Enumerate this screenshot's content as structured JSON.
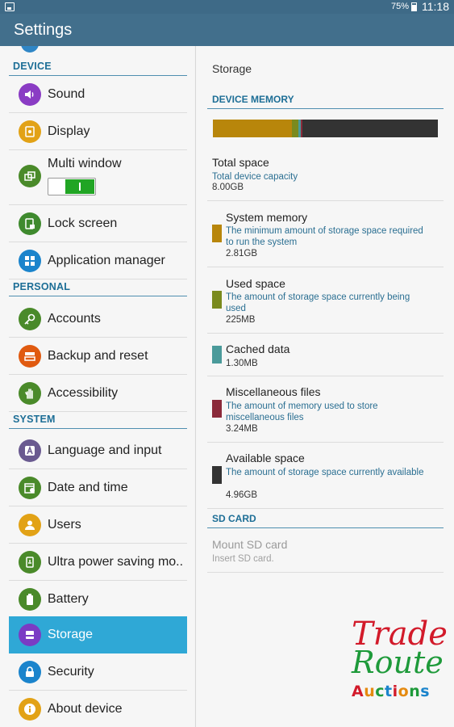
{
  "status": {
    "battery": "75%",
    "time": "11:18"
  },
  "app": {
    "title": "Settings"
  },
  "left": {
    "sections": {
      "device": "DEVICE",
      "personal": "PERSONAL",
      "system": "SYSTEM"
    },
    "items": {
      "sound": "Sound",
      "display": "Display",
      "multi_window": "Multi window",
      "lock_screen": "Lock screen",
      "app_manager": "Application manager",
      "accounts": "Accounts",
      "backup": "Backup and reset",
      "accessibility": "Accessibility",
      "language": "Language and input",
      "date_time": "Date and time",
      "users": "Users",
      "ultra_power": "Ultra power saving mo..",
      "battery": "Battery",
      "storage": "Storage",
      "security": "Security",
      "about": "About device"
    },
    "multi_window_enabled": true,
    "selected": "storage"
  },
  "right": {
    "title": "Storage",
    "device_memory_header": "DEVICE MEMORY",
    "usage_bar": [
      {
        "name": "System memory",
        "fraction": 0.351,
        "color": "#b8860b"
      },
      {
        "name": "Used space",
        "fraction": 0.028,
        "color": "#7a8a1e"
      },
      {
        "name": "Cached data",
        "fraction": 0.01,
        "color": "#4a9a9a"
      },
      {
        "name": "Miscellaneous files",
        "fraction": 0.01,
        "color": "#8b2a3a"
      },
      {
        "name": "Available space",
        "fraction": 0.601,
        "color": "#333333"
      }
    ],
    "total": {
      "name": "Total space",
      "desc": "Total device capacity",
      "value": "8.00GB"
    },
    "system_memory": {
      "name": "System memory",
      "desc": "The minimum amount of storage space required to run the system",
      "value": "2.81GB",
      "color": "#b8860b"
    },
    "used_space": {
      "name": "Used space",
      "desc": "The amount of storage space currently being used",
      "value": "225MB",
      "color": "#7a8a1e"
    },
    "cached": {
      "name": "Cached data",
      "value": "1.30MB",
      "color": "#4a9a9a"
    },
    "misc": {
      "name": "Miscellaneous files",
      "desc": "The amount of memory used to store miscellaneous files",
      "value": "3.24MB",
      "color": "#8b2a3a"
    },
    "available": {
      "name": "Available space",
      "desc": "The amount of storage space currently available",
      "value": "4.96GB",
      "color": "#333333"
    },
    "sd_header": "SD CARD",
    "mount": {
      "name": "Mount SD card",
      "desc": "Insert SD card."
    }
  },
  "watermark": {
    "line1": "Trade",
    "line2": "Route",
    "line3": "Auctions"
  }
}
